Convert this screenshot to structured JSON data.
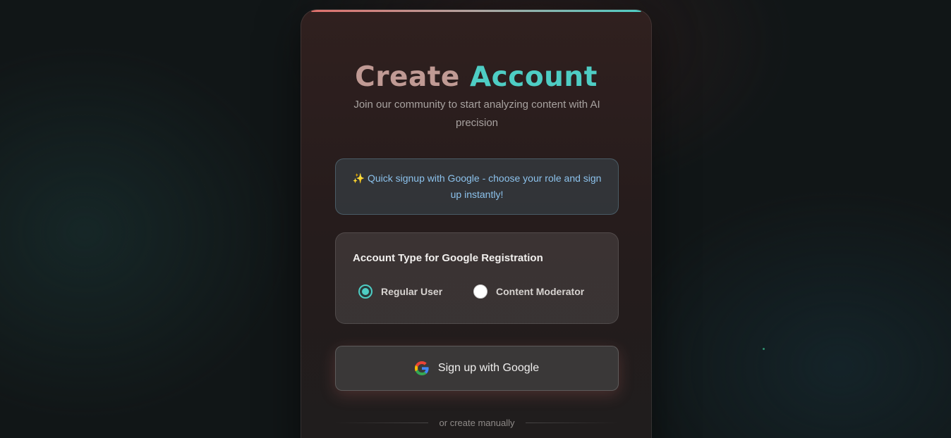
{
  "page": {
    "title_word_1": "Create",
    "title_word_2": "Account",
    "subtitle": "Join our community to start analyzing content with AI precision"
  },
  "notice": {
    "icon": "sparkles-icon",
    "text": "Quick signup with Google - choose your role and sign up instantly!"
  },
  "account_type": {
    "heading": "Account Type for Google Registration",
    "options": [
      {
        "label": "Regular User",
        "selected": true
      },
      {
        "label": "Content Moderator",
        "selected": false
      }
    ]
  },
  "google_button": {
    "icon": "google-g-icon",
    "label": "Sign up with Google"
  },
  "divider": {
    "text": "or create manually"
  },
  "colors": {
    "accent_teal": "#4ecdc4",
    "accent_coral": "#e0706c",
    "notice_text": "#8cc2ec",
    "background": "#111617"
  }
}
